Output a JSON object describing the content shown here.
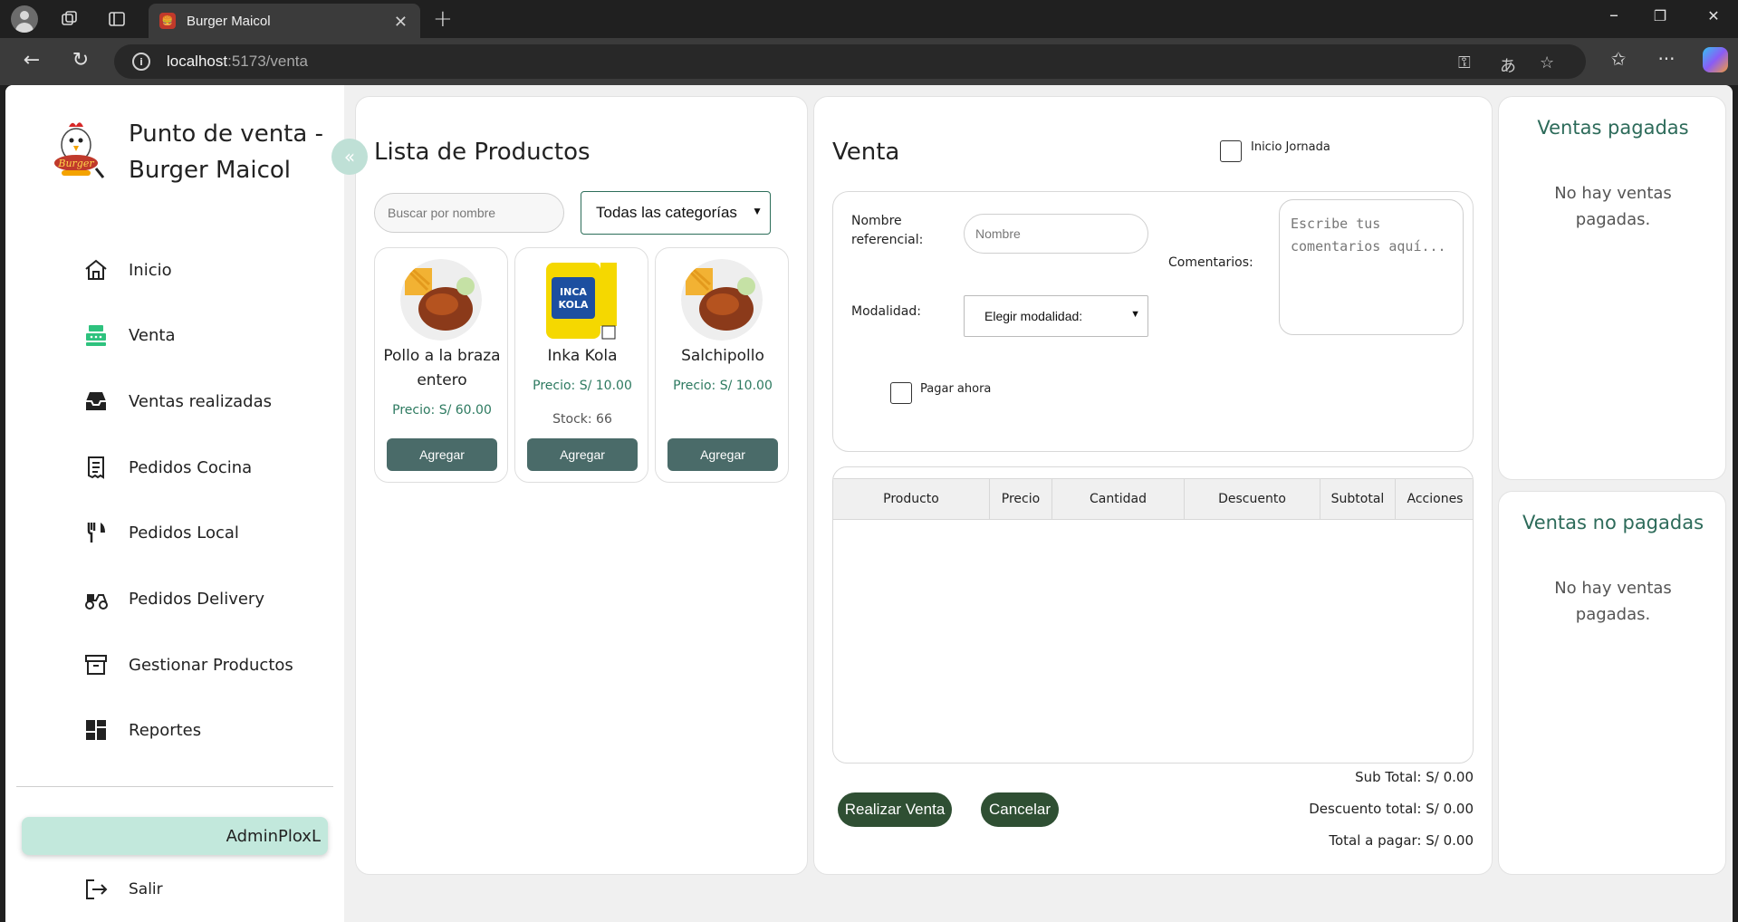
{
  "browser": {
    "tab_title": "Burger Maicol",
    "url_host": "localhost",
    "url_path": ":5173/venta"
  },
  "sidebar": {
    "brand": "Punto de venta - Burger Maicol",
    "collapse_glyph": "«",
    "items": [
      {
        "label": "Inicio",
        "icon": "home-icon"
      },
      {
        "label": "Venta",
        "icon": "cash-register-icon"
      },
      {
        "label": "Ventas realizadas",
        "icon": "inbox-icon"
      },
      {
        "label": "Pedidos Cocina",
        "icon": "receipt-icon"
      },
      {
        "label": "Pedidos Local",
        "icon": "utensils-icon"
      },
      {
        "label": "Pedidos Delivery",
        "icon": "scooter-icon"
      },
      {
        "label": "Gestionar Productos",
        "icon": "archive-icon"
      },
      {
        "label": "Reportes",
        "icon": "dashboard-icon"
      }
    ],
    "user": "AdminPloxL",
    "logout": "Salir"
  },
  "products": {
    "title": "Lista de Productos",
    "search_placeholder": "Buscar por nombre",
    "category_selected": "Todas las categorías",
    "items": [
      {
        "name": "Pollo a la braza entero",
        "price": "Precio: S/ 60.00",
        "stock": "",
        "button": "Agregar"
      },
      {
        "name": "Inka Kola",
        "price": "Precio: S/ 10.00",
        "stock": "Stock: 66",
        "button": "Agregar"
      },
      {
        "name": "Salchipollo",
        "price": "Precio: S/ 10.00",
        "stock": "",
        "button": "Agregar"
      }
    ]
  },
  "sale": {
    "title": "Venta",
    "inicio_jornada": "Inicio Jornada",
    "nombre_label": "Nombre referencial:",
    "nombre_placeholder": "Nombre",
    "comentarios_label": "Comentarios:",
    "comentarios_placeholder": "Escribe tus comentarios aquí...",
    "modalidad_label": "Modalidad:",
    "modalidad_selected": "Elegir modalidad:",
    "pagar_ahora": "Pagar ahora",
    "columns": [
      "Producto",
      "Precio",
      "Cantidad",
      "Descuento",
      "Subtotal",
      "Acciones"
    ],
    "sub_total": "Sub Total: S/ 0.00",
    "descuento_total": "Descuento total: S/ 0.00",
    "total_pagar": "Total a pagar: S/ 0.00",
    "btn_realizar": "Realizar Venta",
    "btn_cancelar": "Cancelar"
  },
  "paid": {
    "title": "Ventas pagadas",
    "empty": "No hay ventas pagadas."
  },
  "unpaid": {
    "title": "Ventas no pagadas",
    "empty": "No hay ventas pagadas."
  },
  "colors": {
    "accent_green": "#2d6b5a",
    "button_teal": "#4a6b69",
    "action_dark_green": "#2f4f33",
    "user_pill": "#c2e8dc"
  }
}
